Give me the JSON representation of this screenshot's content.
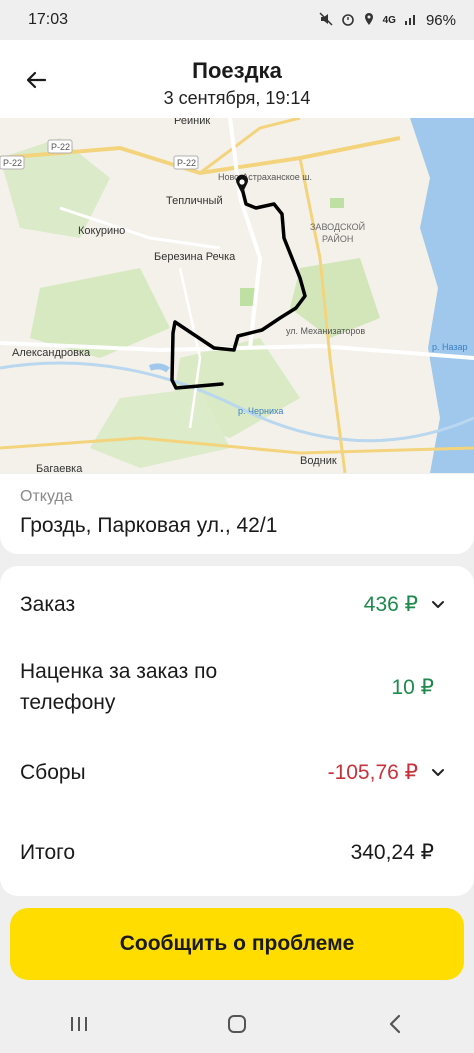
{
  "status_bar": {
    "time": "17:03",
    "network": "4G",
    "battery": "96%",
    "icons": [
      "mute-icon",
      "alarm-icon",
      "location-icon",
      "signal-icon",
      "battery-icon"
    ]
  },
  "header": {
    "title": "Поездка",
    "subtitle": "3 сентября, 19:14"
  },
  "map": {
    "labels": {
      "reinik": "Реиник",
      "r22_top": "Р-22",
      "r22_left": "Р-22",
      "r22_mid": "Р-22",
      "novo": "Ново-Астраханское ш.",
      "teplichny": "Тепличный",
      "zavodskoy1": "ЗАВОДСКОЙ",
      "zavodskoy2": "РАЙОН",
      "kokurino": "Кокурино",
      "berezina": "Березина Речка",
      "mechanizatorov": "ул. Механизаторов",
      "aleksandrovka": "Александровка",
      "chernikha": "р. Черниха",
      "vodnik": "Водник",
      "bagaevka": "Багаевка",
      "nazar": "р. Назар"
    },
    "colors": {
      "land": "#f4f1ea",
      "green": "#cfe6b4",
      "water": "#9fc8ec",
      "route": "#000000"
    }
  },
  "from": {
    "label": "Откуда",
    "value": "Гроздь, Парковая ул., 42/1"
  },
  "price": {
    "order_label": "Заказ",
    "order_value": "436 ₽",
    "surcharge_label": "Наценка за заказ по телефону",
    "surcharge_value": "10 ₽",
    "fees_label": "Сборы",
    "fees_value": "-105,76 ₽",
    "total_label": "Итого",
    "total_value": "340,24 ₽",
    "colors": {
      "positive": "#1e8a4c",
      "negative": "#c8323b"
    }
  },
  "report_button": {
    "label": "Сообщить о проблеме",
    "color": "#ffdd00"
  },
  "nav": {
    "icons": [
      "recent-apps-icon",
      "home-icon",
      "back-nav-icon"
    ]
  }
}
